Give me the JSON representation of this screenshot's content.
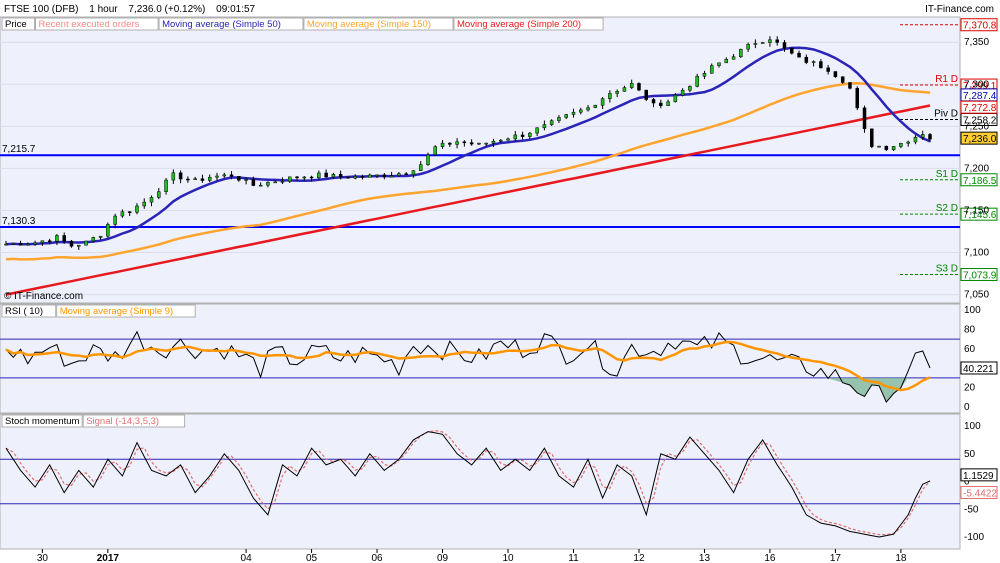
{
  "header": {
    "instrument": "FTSE 100 (DFB)",
    "timeframe": "1 hour",
    "last_change": "7,236.0 (+0.12%)",
    "time": "09:01:57",
    "brand": "IT-Finance.com"
  },
  "price_panel": {
    "legend": [
      "Price",
      "Recent executed orders",
      "Moving average (Simple 50)",
      "Moving average (Simple 150)",
      "Moving average (Simple 200)"
    ],
    "watermark": "© IT-Finance.com",
    "y_ticks": [
      7350,
      7300,
      7250,
      7200,
      7150,
      7100,
      7050
    ],
    "y_tick_labels": [
      "7,350",
      "7,300",
      "7,250",
      "7,200",
      "7,150",
      "7,100",
      "7,050"
    ],
    "hlines": [
      {
        "value": 7215.7,
        "label": "7,215.7",
        "color": "#0000ff"
      },
      {
        "value": 7130.3,
        "label": "7,130.3",
        "color": "#0000ff"
      }
    ],
    "pivots": [
      {
        "name": "R1 D",
        "value": 7299.1,
        "value_label": "7,299.1",
        "color": "#dd0000"
      },
      {
        "name": "Piv D",
        "value": 7258.2,
        "value_label": "7,258.2",
        "color": "#000000"
      },
      {
        "name": "S1 D",
        "value": 7186.5,
        "value_label": "7,186.5",
        "color": "#008800"
      },
      {
        "name": "S2 D",
        "value": 7145.6,
        "value_label": "7,145.6",
        "color": "#008800"
      },
      {
        "name": "S3 D",
        "value": 7073.9,
        "value_label": "7,073.9",
        "color": "#008800"
      }
    ],
    "top_level": {
      "value": 7370.8,
      "label": "7,370.8",
      "color": "#dd0000"
    },
    "axis_tags": [
      {
        "value": 7287.4,
        "label": "7,287.4",
        "color": "#0000aa",
        "fill": "#ffffff"
      },
      {
        "value": 7272.8,
        "label": "7,272.8",
        "color": "#dd0000",
        "fill": "#ffffff"
      },
      {
        "value": 7236.0,
        "label": "7,236.0",
        "color": "#000000",
        "fill": "#ffcc33"
      }
    ]
  },
  "rsi_panel": {
    "legend": [
      "RSI ( 10)",
      "Moving average (Simple 9)"
    ],
    "y_ticks": [
      100,
      80,
      60,
      40,
      20,
      0
    ],
    "levels": [
      70,
      30
    ],
    "current_label": "40.221",
    "current_value": 40.221
  },
  "stoch_panel": {
    "legend": [
      "Stoch momentum",
      "Signal (-14,3,5,3)"
    ],
    "y_ticks": [
      100,
      50,
      0,
      -50,
      -100
    ],
    "levels": [
      40,
      -40
    ],
    "current_labels": [
      "1.1529",
      "-5.4422"
    ],
    "current_values": [
      1.1529,
      -5.4422
    ]
  },
  "x_axis": {
    "labels": [
      {
        "bar": 5,
        "text": "30",
        "bold": false
      },
      {
        "bar": 14,
        "text": "2017",
        "bold": true
      },
      {
        "bar": 33,
        "text": "04",
        "bold": false
      },
      {
        "bar": 42,
        "text": "05",
        "bold": false
      },
      {
        "bar": 51,
        "text": "06",
        "bold": false
      },
      {
        "bar": 60,
        "text": "09",
        "bold": false
      },
      {
        "bar": 69,
        "text": "10",
        "bold": false
      },
      {
        "bar": 78,
        "text": "11",
        "bold": false
      },
      {
        "bar": 87,
        "text": "12",
        "bold": false
      },
      {
        "bar": 96,
        "text": "13",
        "bold": false
      },
      {
        "bar": 105,
        "text": "16",
        "bold": false
      },
      {
        "bar": 114,
        "text": "17",
        "bold": false
      },
      {
        "bar": 123,
        "text": "18",
        "bold": false
      }
    ]
  },
  "chart_data": {
    "type": "line",
    "title": "FTSE 100 (DFB)",
    "price_ylim": [
      7040,
      7380
    ],
    "close_keypoints": [
      [
        0,
        7110
      ],
      [
        4,
        7112
      ],
      [
        7,
        7118
      ],
      [
        9,
        7108
      ],
      [
        11,
        7112
      ],
      [
        13,
        7122
      ],
      [
        15,
        7145
      ],
      [
        17,
        7150
      ],
      [
        19,
        7160
      ],
      [
        21,
        7175
      ],
      [
        23,
        7192
      ],
      [
        26,
        7185
      ],
      [
        28,
        7190
      ],
      [
        31,
        7192
      ],
      [
        34,
        7180
      ],
      [
        37,
        7185
      ],
      [
        40,
        7190
      ],
      [
        43,
        7192
      ],
      [
        46,
        7190
      ],
      [
        49,
        7190
      ],
      [
        52,
        7192
      ],
      [
        55,
        7195
      ],
      [
        57,
        7205
      ],
      [
        59,
        7225
      ],
      [
        62,
        7232
      ],
      [
        65,
        7228
      ],
      [
        68,
        7235
      ],
      [
        71,
        7240
      ],
      [
        74,
        7250
      ],
      [
        77,
        7262
      ],
      [
        80,
        7272
      ],
      [
        83,
        7290
      ],
      [
        86,
        7300
      ],
      [
        89,
        7275
      ],
      [
        91,
        7280
      ],
      [
        94,
        7300
      ],
      [
        97,
        7320
      ],
      [
        100,
        7335
      ],
      [
        103,
        7350
      ],
      [
        105,
        7355
      ],
      [
        107,
        7342
      ],
      [
        109,
        7330
      ],
      [
        111,
        7325
      ],
      [
        113,
        7318
      ],
      [
        115,
        7305
      ],
      [
        116,
        7295
      ],
      [
        117,
        7270
      ],
      [
        118,
        7245
      ],
      [
        119,
        7228
      ],
      [
        121,
        7225
      ],
      [
        123,
        7230
      ],
      [
        125,
        7238
      ],
      [
        126,
        7242
      ],
      [
        127,
        7236
      ]
    ],
    "rsi_keypoints": [
      [
        0,
        60
      ],
      [
        3,
        50
      ],
      [
        6,
        62
      ],
      [
        9,
        45
      ],
      [
        12,
        58
      ],
      [
        15,
        52
      ],
      [
        18,
        72
      ],
      [
        21,
        60
      ],
      [
        24,
        65
      ],
      [
        27,
        58
      ],
      [
        30,
        60
      ],
      [
        33,
        50
      ],
      [
        35,
        40
      ],
      [
        37,
        55
      ],
      [
        40,
        48
      ],
      [
        43,
        58
      ],
      [
        46,
        50
      ],
      [
        49,
        55
      ],
      [
        52,
        50
      ],
      [
        54,
        42
      ],
      [
        56,
        65
      ],
      [
        59,
        62
      ],
      [
        62,
        55
      ],
      [
        65,
        50
      ],
      [
        68,
        65
      ],
      [
        71,
        60
      ],
      [
        74,
        70
      ],
      [
        77,
        55
      ],
      [
        80,
        65
      ],
      [
        82,
        50
      ],
      [
        84,
        38
      ],
      [
        86,
        62
      ],
      [
        89,
        58
      ],
      [
        92,
        70
      ],
      [
        95,
        60
      ],
      [
        98,
        68
      ],
      [
        101,
        55
      ],
      [
        104,
        50
      ],
      [
        107,
        45
      ],
      [
        110,
        42
      ],
      [
        112,
        36
      ],
      [
        114,
        32
      ],
      [
        116,
        25
      ],
      [
        118,
        15
      ],
      [
        120,
        12
      ],
      [
        122,
        18
      ],
      [
        124,
        30
      ],
      [
        125,
        45
      ],
      [
        126,
        52
      ],
      [
        127,
        40.2
      ]
    ],
    "stoch_keypoints": [
      [
        0,
        60
      ],
      [
        2,
        20
      ],
      [
        4,
        -10
      ],
      [
        6,
        30
      ],
      [
        8,
        -20
      ],
      [
        10,
        20
      ],
      [
        12,
        -10
      ],
      [
        14,
        40
      ],
      [
        16,
        10
      ],
      [
        18,
        70
      ],
      [
        20,
        20
      ],
      [
        22,
        10
      ],
      [
        24,
        30
      ],
      [
        26,
        -20
      ],
      [
        28,
        10
      ],
      [
        30,
        50
      ],
      [
        32,
        20
      ],
      [
        34,
        -30
      ],
      [
        36,
        -60
      ],
      [
        38,
        30
      ],
      [
        40,
        10
      ],
      [
        42,
        60
      ],
      [
        44,
        30
      ],
      [
        46,
        40
      ],
      [
        48,
        10
      ],
      [
        50,
        50
      ],
      [
        52,
        20
      ],
      [
        54,
        40
      ],
      [
        56,
        75
      ],
      [
        58,
        90
      ],
      [
        60,
        85
      ],
      [
        62,
        50
      ],
      [
        64,
        30
      ],
      [
        66,
        60
      ],
      [
        68,
        20
      ],
      [
        70,
        40
      ],
      [
        72,
        20
      ],
      [
        74,
        60
      ],
      [
        76,
        10
      ],
      [
        78,
        -10
      ],
      [
        80,
        40
      ],
      [
        82,
        -30
      ],
      [
        84,
        30
      ],
      [
        86,
        10
      ],
      [
        88,
        -60
      ],
      [
        90,
        50
      ],
      [
        92,
        40
      ],
      [
        94,
        80
      ],
      [
        96,
        50
      ],
      [
        98,
        20
      ],
      [
        100,
        -20
      ],
      [
        102,
        40
      ],
      [
        104,
        75
      ],
      [
        106,
        30
      ],
      [
        108,
        -10
      ],
      [
        110,
        -60
      ],
      [
        112,
        -75
      ],
      [
        114,
        -80
      ],
      [
        116,
        -90
      ],
      [
        118,
        -95
      ],
      [
        120,
        -100
      ],
      [
        122,
        -95
      ],
      [
        124,
        -60
      ],
      [
        125,
        -30
      ],
      [
        126,
        -5
      ],
      [
        127,
        1.15
      ]
    ],
    "bar_count": 128
  }
}
